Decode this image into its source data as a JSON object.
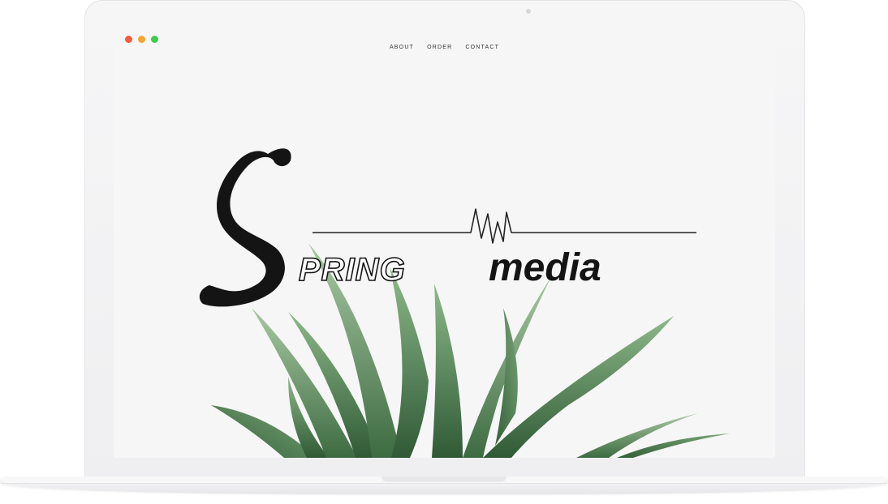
{
  "window": {
    "traffic_lights": [
      {
        "name": "close",
        "color": "#f25b3c"
      },
      {
        "name": "minimize",
        "color": "#f7a52f"
      },
      {
        "name": "maximize",
        "color": "#3fcc4f"
      }
    ]
  },
  "nav": {
    "items": [
      {
        "id": "about",
        "label": "ABOUT"
      },
      {
        "id": "order",
        "label": "ORDER"
      },
      {
        "id": "contact",
        "label": "CONTACT"
      }
    ]
  },
  "logo": {
    "part1": "PRING",
    "part2": "media"
  },
  "colors": {
    "screen_bg": "#f6f6f6",
    "ink": "#141414",
    "leaf_dark": "#3f6e44",
    "leaf_light": "#8fb78c"
  }
}
